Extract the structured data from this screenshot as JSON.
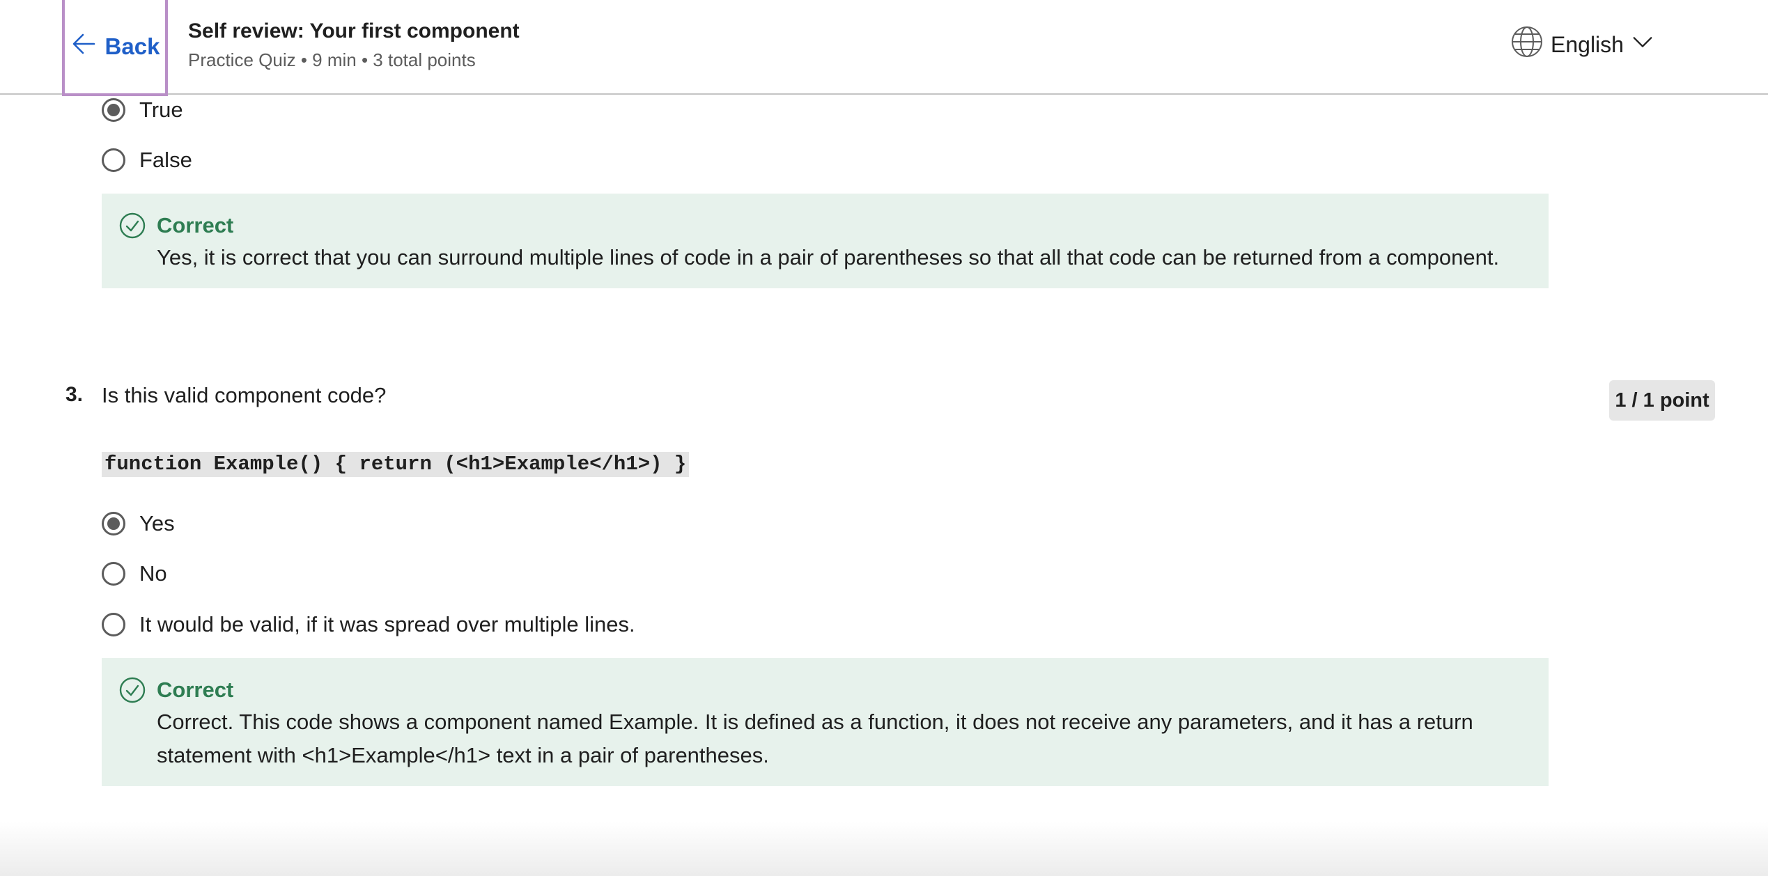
{
  "header": {
    "back_label": "Back",
    "title": "Self review: Your first component",
    "subtitle": "Practice Quiz • 9 min • 3 total points",
    "language": "English"
  },
  "question2": {
    "options": [
      {
        "label": "True",
        "selected": true
      },
      {
        "label": "False",
        "selected": false
      }
    ],
    "feedback": {
      "title": "Correct",
      "text": "Yes, it is correct that you can surround multiple lines of code in a pair of parentheses so that all that code can be returned from a component."
    }
  },
  "question3": {
    "number": "3.",
    "text": "Is this valid component code?",
    "points": "1 / 1 point",
    "code": "function Example() { return (<h1>Example</h1>) }",
    "options": [
      {
        "label": "Yes",
        "selected": true
      },
      {
        "label": "No",
        "selected": false
      },
      {
        "label": "It would be valid, if it was spread over multiple lines.",
        "selected": false
      }
    ],
    "feedback": {
      "title": "Correct",
      "text": "Correct. This code shows a component named Example. It is defined as a function, it does not receive any parameters, and it has a return statement with <h1>Example</h1> text in a pair of parentheses."
    }
  },
  "colors": {
    "accent": "#1f5fc8",
    "correct": "#2e7d52",
    "feedback_bg": "#e7f2ec",
    "focus_outline": "#b98fc7"
  }
}
